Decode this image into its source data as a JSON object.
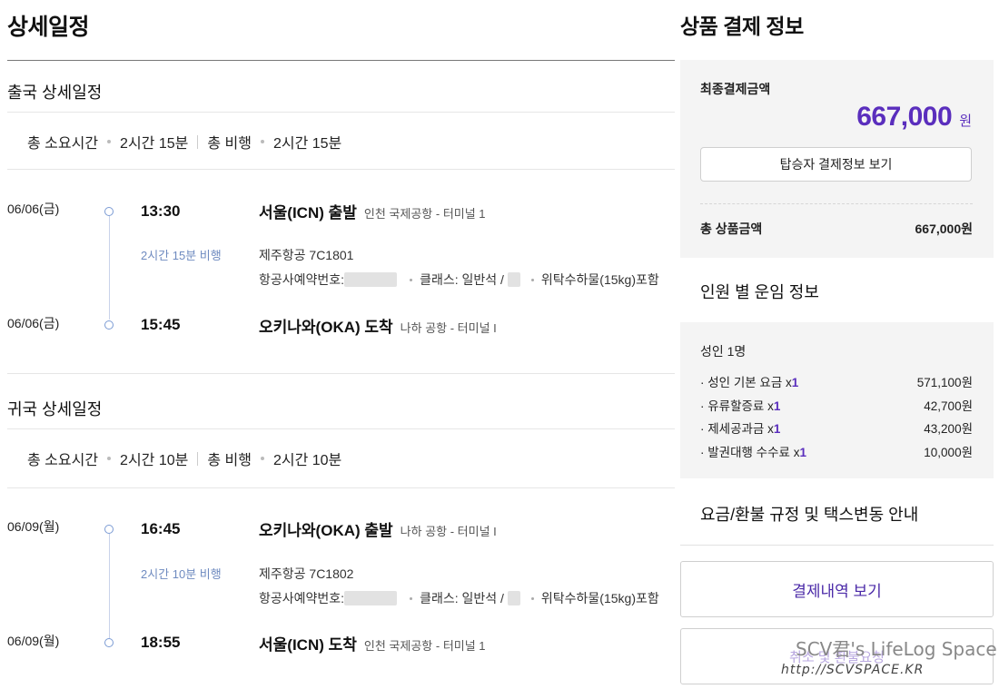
{
  "page_title": "상세일정",
  "outbound": {
    "section_title": "출국 상세일정",
    "summary": {
      "total_label": "총 소요시간",
      "total_value": "2시간 15분",
      "flight_label": "총 비행",
      "flight_value": "2시간 15분"
    },
    "depart": {
      "date": "06/06(금)",
      "time": "13:30",
      "place": "서울(ICN) 출발",
      "airport": "인천 국제공항 - 터미널 1"
    },
    "duration": "2시간 15분 비행",
    "flight_no": "제주항공 7C1801",
    "booking_label": "항공사예약번호:",
    "class_label": "클래스: 일반석 /",
    "baggage": "위탁수하물(15kg)포함",
    "arrive": {
      "date": "06/06(금)",
      "time": "15:45",
      "place": "오키나와(OKA) 도착",
      "airport": "나하 공항 - 터미널 I"
    }
  },
  "return": {
    "section_title": "귀국 상세일정",
    "summary": {
      "total_label": "총 소요시간",
      "total_value": "2시간 10분",
      "flight_label": "총 비행",
      "flight_value": "2시간 10분"
    },
    "depart": {
      "date": "06/09(월)",
      "time": "16:45",
      "place": "오키나와(OKA) 출발",
      "airport": "나하 공항 - 터미널 I"
    },
    "duration": "2시간 10분 비행",
    "flight_no": "제주항공 7C1802",
    "booking_label": "항공사예약번호:",
    "class_label": "클래스: 일반석 /",
    "baggage": "위탁수하물(15kg)포함",
    "arrive": {
      "date": "06/09(월)",
      "time": "18:55",
      "place": "서울(ICN) 도착",
      "airport": "인천 국제공항 - 터미널 1"
    }
  },
  "payment": {
    "title": "상품 결제 정보",
    "final_label": "최종결제금액",
    "final_amount": "667,000",
    "final_unit": "원",
    "passenger_button": "탑승자 결제정보 보기",
    "total_label": "총 상품금액",
    "total_value": "667,000원"
  },
  "fare_info": {
    "title": "인원 별 운임 정보",
    "group": "성인 1명",
    "rows": [
      {
        "label": "· 성인 기본 요금 x",
        "qty": "1",
        "value": "571,100원"
      },
      {
        "label": "· 유류할증료 x",
        "qty": "1",
        "value": "42,700원"
      },
      {
        "label": "· 제세공과금 x",
        "qty": "1",
        "value": "43,200원"
      },
      {
        "label": "· 발권대행 수수료 x",
        "qty": "1",
        "value": "10,000원"
      }
    ]
  },
  "policy_title": "요금/환불 규정 및 택스변동 안내",
  "buttons": {
    "history": "결제내역 보기",
    "cancel": "취소 및 환불요청"
  },
  "watermark": {
    "line1": "SCV君's LifeLog Space",
    "line2": "http://SCVSPACE.KR"
  },
  "colors": {
    "accent": "#5a2ebd",
    "timeline": "#7b9bd4",
    "panel_bg": "#f4f4f4"
  }
}
